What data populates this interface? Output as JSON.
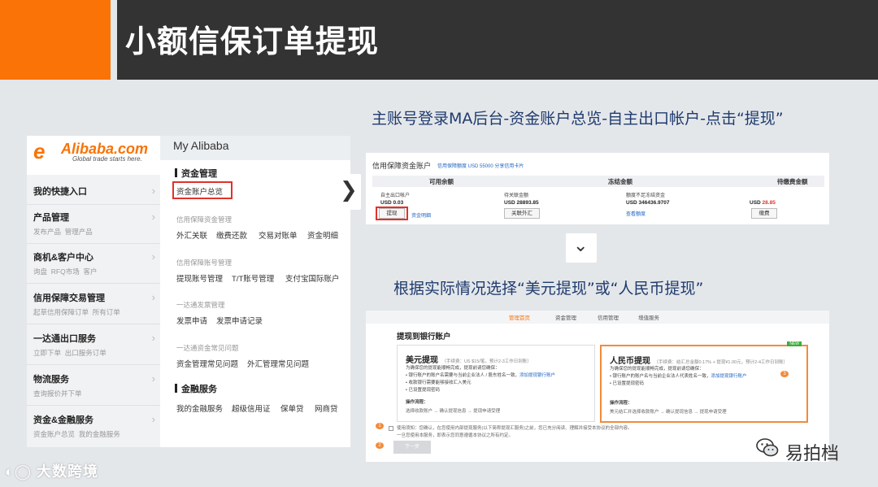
{
  "header": {
    "title": "小额信保订单提现",
    "accent_color": "#f97306",
    "bar_color": "#333333"
  },
  "captions": {
    "step1": "主账号登录MA后台-资金账户总览-自主出口帐户-点击“提现”",
    "step2": "根据实际情况选择“美元提现”或“人民币提现”"
  },
  "left_panel": {
    "logo": {
      "brand": "Alibaba.com",
      "tagline": "Global trade starts here."
    },
    "title": "My Alibaba",
    "sidebar": [
      {
        "label": "我的快捷入口",
        "subs": []
      },
      {
        "label": "产品管理",
        "subs": [
          "发布产品",
          "管理产品"
        ]
      },
      {
        "label": "商机&客户中心",
        "subs": [
          "询盘",
          "RFQ市场",
          "客户"
        ]
      },
      {
        "label": "信用保障交易管理",
        "subs": [
          "起草信用保障订单",
          "所有订单"
        ]
      },
      {
        "label": "一达通出口服务",
        "subs": [
          "立即下单",
          "出口服务订单"
        ]
      },
      {
        "label": "物流服务",
        "subs": [
          "查询报价并下单"
        ]
      },
      {
        "label": "资金&金融服务",
        "subs": [
          "资金账户总览",
          "我的金融服务"
        ]
      }
    ],
    "menu": {
      "section1": "资金管理",
      "highlight": "资金账户总览",
      "group1_title": "信用保障资金管理",
      "group1_links": [
        "外汇关联",
        "缴费还款",
        "交易对账单",
        "资金明细"
      ],
      "group2_title": "信用保障账号管理",
      "group2_links": [
        "提现账号管理",
        "T/T账号管理",
        "支付宝国际账户"
      ],
      "group3_title": "一达通发票管理",
      "group3_links": [
        "发票申请",
        "发票申请记录"
      ],
      "group4_title": "一达通资金常见问题",
      "group4_links": [
        "资金管理常见问题",
        "外汇管理常见问题"
      ],
      "section2": "金融服务",
      "group5_links": [
        "我的金融服务",
        "超级信用证",
        "保单贷",
        "网商贷"
      ]
    }
  },
  "account_panel": {
    "title": "信用保障资金账户",
    "note": "信用保障额度 USD 55000 分享信用卡片",
    "columns": [
      "可用余额",
      "冻结金额",
      "待缴费金额"
    ],
    "available": {
      "label": "自主出口帐户",
      "amount": "USD 0.03",
      "withdraw": "提现",
      "detail": "资金明细"
    },
    "pending": {
      "label": "待关联金额",
      "amount": "USD 28893.85",
      "button": "关联外汇"
    },
    "frozen": {
      "label": "额度不足冻结资金",
      "amount": "USD 346436.9707",
      "link": "查看额度"
    },
    "fee": {
      "amount_prefix": "USD",
      "amount": "28.85",
      "button": "缴费"
    }
  },
  "withdraw_panel": {
    "nav": [
      "管理首页",
      "资金管理",
      "信用管理",
      "增值服务"
    ],
    "title": "提现到银行账户",
    "usd_card": {
      "title": "美元提现",
      "fee": "（手续费：US $15/笔，预计2-3工作日到账）",
      "intro": "为确保您的提现能顺畅完成，提现前请您确保：",
      "line1": "• 银行账户的账户名需要与当前企业法人 / 股东姓名一致，",
      "link1": "添加提现银行账户",
      "line2": "• 收款银行需要能够接收汇入美元",
      "link2": "• 已设置提现密码",
      "flow_title": "操作流程：",
      "flow": "选择收款账户 → 确认提现信息 → 提现申请受理"
    },
    "cny_card": {
      "badge": "NEW",
      "title": "人民币提现",
      "fee": "（手续费：结汇总金额0.17% + 提现¥1.00元，预计2-4工作日到账）",
      "intro": "为确保您的提现能顺畅完成，提现前请您确保：",
      "line1": "• 银行账户的账户名与当前企业法人代表姓名一致，",
      "link1": "添加提现银行账户",
      "link2": "• 已设置提现密码",
      "flow_title": "操作流程：",
      "flow": "美元结汇并选择收款账户 → 确认提现信息 → 提现申请受理"
    },
    "agreement": "使用须知：您确认，在您使用内部提现服务(以下简称提现汇服务)之前，您已充分阅读、理解并接受本协议的全部内容。",
    "agreement2": "一旦您使用本服务，即表示您同意遵循本协议之所有约定。",
    "next_button": "下一步",
    "markers": [
      "1",
      "2",
      "3"
    ]
  },
  "watermarks": {
    "left": "大数跨境",
    "right": "易拍档"
  }
}
